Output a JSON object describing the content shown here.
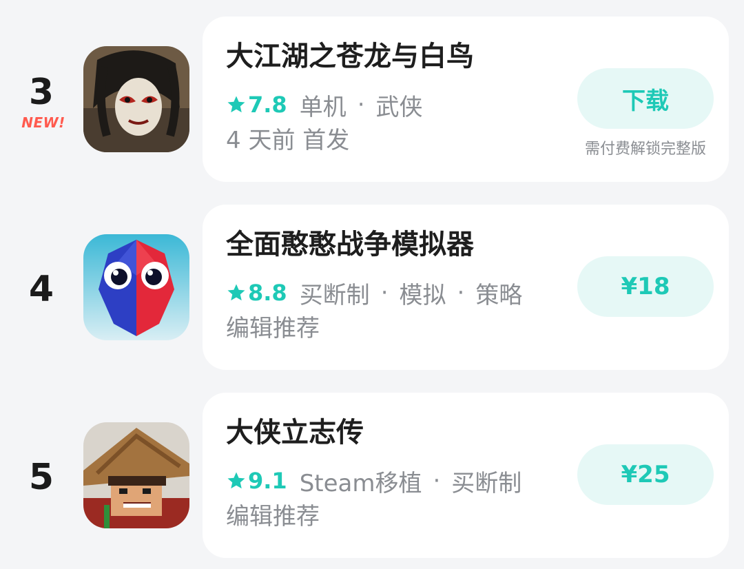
{
  "games": [
    {
      "rank": "3",
      "badge": "NEW!",
      "icon": "ink-warrior-face-icon",
      "title": "大江湖之苍龙与白鸟",
      "rating": "7.8",
      "tags": [
        "单机",
        "武侠"
      ],
      "subtitle": "4 天前 首发",
      "action_label": "下载",
      "action_note": "需付费解锁完整版"
    },
    {
      "rank": "4",
      "icon": "red-blue-gem-character-icon",
      "title": "全面憨憨战争模拟器",
      "rating": "8.8",
      "tags": [
        "买断制",
        "模拟",
        "策略"
      ],
      "subtitle": "编辑推荐",
      "action_label": "¥18"
    },
    {
      "rank": "5",
      "icon": "pixel-straw-hat-swordsman-icon",
      "title": "大侠立志传",
      "rating": "9.1",
      "tags": [
        "Steam移植",
        "买断制"
      ],
      "subtitle": "编辑推荐",
      "action_label": "¥25"
    }
  ],
  "colors": {
    "accent": "#1ec9b6",
    "accent_bg": "#e6f8f6",
    "badge": "#ff5a4e"
  }
}
